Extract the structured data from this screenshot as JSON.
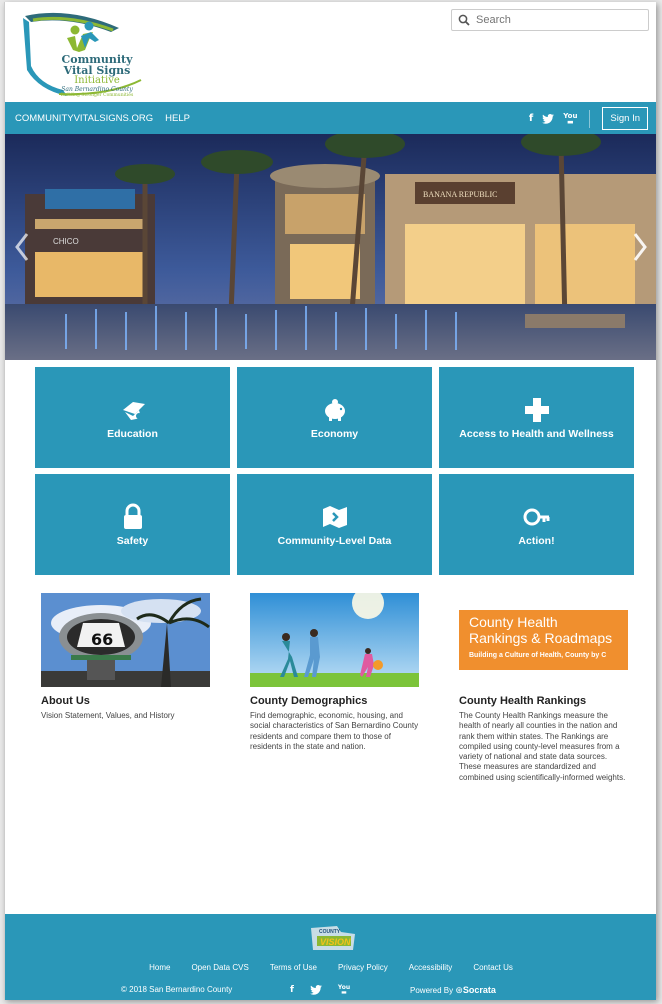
{
  "header": {
    "logo": {
      "line1": "Community",
      "line2": "Vital Signs",
      "line3": "Initiative",
      "line4": "San Bernardino County",
      "line5": "Building Stronger Communities"
    },
    "search_placeholder": "Search"
  },
  "nav": {
    "links": [
      "COMMUNITYVITALSIGNS.ORG",
      "HELP"
    ],
    "social_icons": [
      "facebook-icon",
      "twitter-icon",
      "youtube-icon"
    ],
    "youtube_label": "You",
    "sign_in": "Sign In"
  },
  "tiles": [
    {
      "label": "Education",
      "icon": "education-icon"
    },
    {
      "label": "Economy",
      "icon": "piggy-bank-icon"
    },
    {
      "label": "Access to Health and Wellness",
      "icon": "medical-cross-icon"
    },
    {
      "label": "Safety",
      "icon": "lock-icon"
    },
    {
      "label": "Community-Level Data",
      "icon": "map-icon"
    },
    {
      "label": "Action!",
      "icon": "key-icon"
    }
  ],
  "cards": [
    {
      "title": "About Us",
      "text": "Vision Statement, Values, and History"
    },
    {
      "title": "County Demographics",
      "text": "Find demographic, economic, housing, and social characteristics of San Bernardino County residents and compare them to those of residents in the state and nation."
    },
    {
      "title": "County Health Rankings",
      "text": "The County Health Rankings measure the health of nearly all counties in the nation and rank them within states. The Rankings are compiled using county-level measures from a variety of national and state data sources. These measures are standardized and combined using scientifically-informed weights."
    }
  ],
  "card_images": {
    "route66": "66",
    "chr_title_1": "County Health",
    "chr_title_2": "Rankings & Roadmaps",
    "chr_subtitle": "Building a Culture of Health, County by C"
  },
  "hero": {
    "store1": "CHICO",
    "store2": "BANANA REPUBLIC"
  },
  "footer": {
    "logo_text_1": "COUNTY",
    "logo_text_2": "VISION",
    "links": [
      "Home",
      "Open Data CVS",
      "Terms of Use",
      "Privacy Policy",
      "Accessibility",
      "Contact Us"
    ],
    "copyright": "© 2018 San Bernardino County",
    "powered_by": "Powered By",
    "socrata": "Socrata"
  },
  "colors": {
    "brand_blue": "#2a97b8",
    "logo_green": "#8cb833",
    "logo_teal": "#2e6b7a"
  }
}
